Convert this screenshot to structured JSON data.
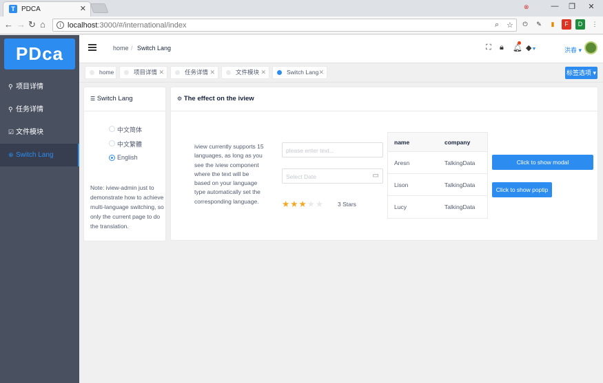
{
  "browser": {
    "tab_title": "PDCA",
    "favicon_letter": "T",
    "url_host": "localhost",
    "url_path": ":3000/#/international/index",
    "ext_icons": [
      "key-icon",
      "pen-icon",
      "bookmark-icon",
      "pdf-icon",
      "doc-icon"
    ]
  },
  "sidebar": {
    "logo": "PDca",
    "items": [
      {
        "label": "项目详情",
        "icon": "search-icon"
      },
      {
        "label": "任务详情",
        "icon": "search-icon"
      },
      {
        "label": "文件模块",
        "icon": "edit-icon"
      },
      {
        "label": "Switch Lang",
        "icon": "globe-icon"
      }
    ]
  },
  "header": {
    "breadcrumb_home": "home",
    "breadcrumb_current": "Switch Lang",
    "user_name": "洪春"
  },
  "tags": [
    {
      "label": "home",
      "closable": false
    },
    {
      "label": "项目详情",
      "closable": true
    },
    {
      "label": "任务详情",
      "closable": true
    },
    {
      "label": "文件模块",
      "closable": true
    },
    {
      "label": "Switch Lang",
      "closable": true
    }
  ],
  "tag_options_label": "标签选项",
  "switch_card": {
    "title": "Switch Lang",
    "options": [
      "中文简体",
      "中文繁體",
      "English"
    ],
    "selected": "English",
    "note": "Note: iview-admin just to demonstrate how to achieve multi-language switching, so only the current page to do the translation."
  },
  "effect_card": {
    "title": "The effect on the iview",
    "description": "iview currently supports 15 languages, as long as you see the iview component where the text will be based on your language type automatically set the corresponding language.",
    "input_placeholder": "please enter text...",
    "date_placeholder": "Select Date",
    "rating": 3,
    "rating_max": 5,
    "rating_text": "3 Stars",
    "table": {
      "columns": [
        "name",
        "company"
      ],
      "rows": [
        [
          "Aresn",
          "TalkingData"
        ],
        [
          "Lison",
          "TalkingData"
        ],
        [
          "Lucy",
          "TalkingData"
        ]
      ]
    },
    "modal_button": "Click to show modal",
    "poptip_button": "Click to show poptip"
  },
  "colors": {
    "primary": "#2d8cf0",
    "sidebar_bg": "#495060",
    "star": "#f5a623"
  }
}
